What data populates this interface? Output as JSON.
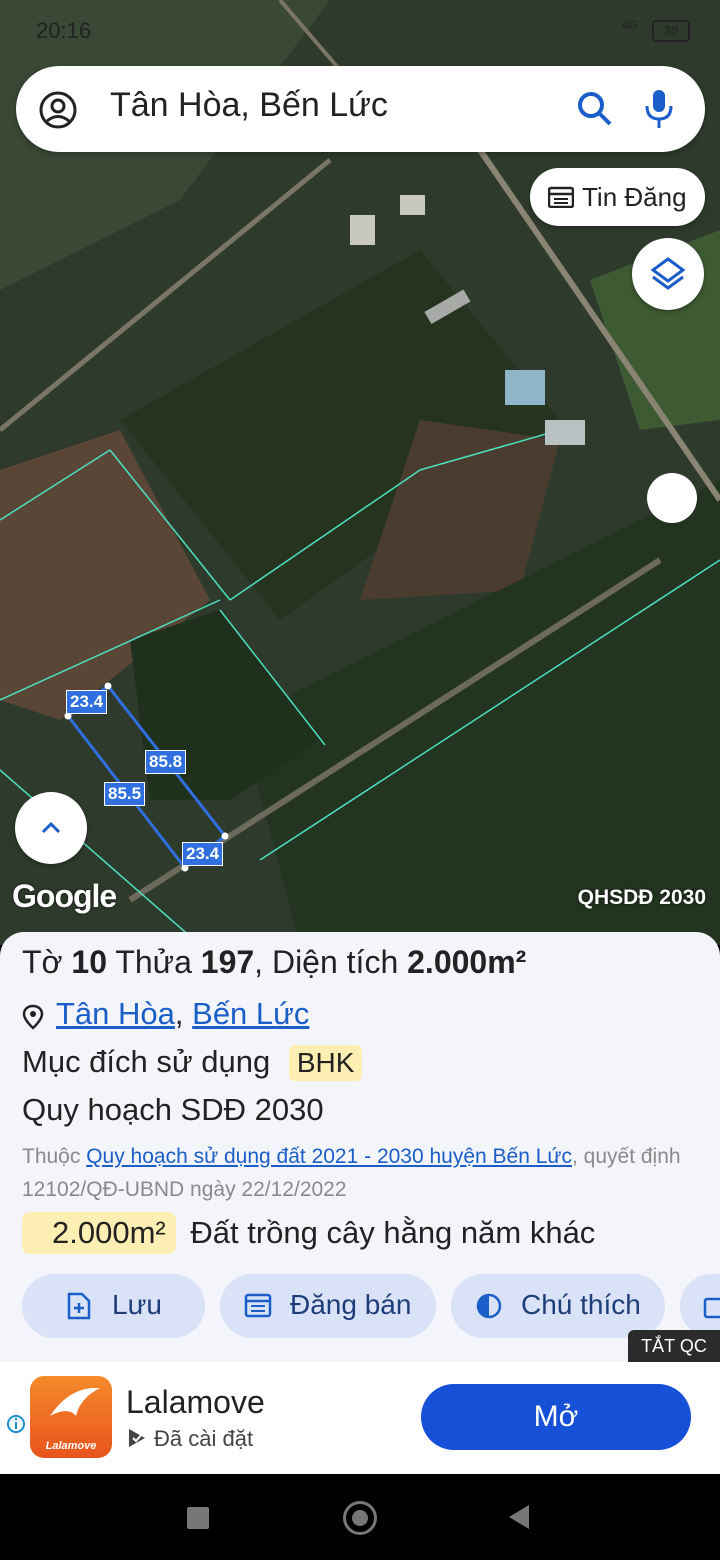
{
  "status_bar": {
    "time": "20:16",
    "battery": "38",
    "network": "4G"
  },
  "search": {
    "query": "Tân Hòa, Bến Lức"
  },
  "map": {
    "tin_dang_label": "Tin Đăng",
    "google_label": "Google",
    "layer_label": "QHSDĐ 2030",
    "dimensions": [
      "23.4",
      "85.8",
      "85.5",
      "23.4"
    ]
  },
  "parcel": {
    "to_label": "Tờ",
    "to_value": "10",
    "thua_label": "Thửa",
    "thua_value": "197",
    "area_label": "Diện tích",
    "area_value": "2.000m²",
    "location_ward": "Tân Hòa",
    "location_sep": ", ",
    "location_district": "Bến Lức",
    "purpose_label": "Mục đích sử dụng",
    "purpose_code": "BHK",
    "plan_title": "Quy hoạch SDĐ 2030",
    "belongs_prefix": "Thuộc ",
    "belongs_link": "Quy hoạch sử dụng đất 2021 - 2030 huyện Bến Lức",
    "belongs_suffix": ", quyết định 12102/QĐ-UBND ngày 22/12/2022",
    "land_area": "2.000m²",
    "land_type": "Đất trồng cây hằng năm khác"
  },
  "actions": {
    "save": "Lưu",
    "sell": "Đăng bán",
    "legend": "Chú thích"
  },
  "ad": {
    "hide_label": "TẮT QC",
    "app_name": "Lalamove",
    "logo_text": "Lalamove",
    "installed": "Đã cài đặt",
    "open_label": "Mở"
  }
}
